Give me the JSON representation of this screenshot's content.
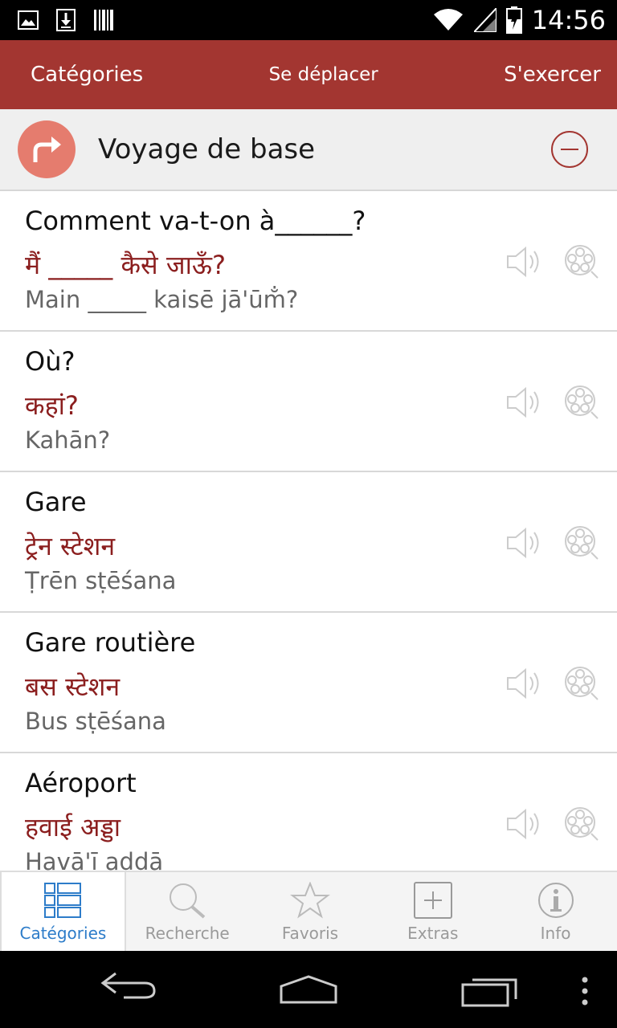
{
  "status_bar": {
    "time": "14:56",
    "icons": [
      "image-notification-icon",
      "download-notification-icon",
      "barcode-notification-icon",
      "wifi-icon",
      "signal-icon",
      "battery-icon"
    ]
  },
  "action_bar": {
    "left": "Catégories",
    "center": "Se déplacer",
    "right": "S'exercer",
    "color": "#a33631"
  },
  "category": {
    "title": "Voyage de base",
    "icon": "turn-right-arrow-icon",
    "icon_color": "#e57c6e"
  },
  "phrases": [
    {
      "french": "Comment va-t-on à______?",
      "hindi": "मैं _____  कैसे जाऊँ?",
      "translit": "Main _____ kaisē jā'ūm̐?"
    },
    {
      "french": "Où?",
      "hindi": "कहां?",
      "translit": "Kahān?"
    },
    {
      "french": "Gare",
      "hindi": "ट्रेन स्टेशन",
      "translit": "Ṭrēn sṭēśana"
    },
    {
      "french": "Gare routière",
      "hindi": "बस स्टेशन",
      "translit": "Bus sṭēśana"
    },
    {
      "french": "Aéroport",
      "hindi": "हवाई अड्डा",
      "translit": "Havā'ī aḍḍā"
    }
  ],
  "tabs": [
    {
      "label": "Catégories",
      "icon": "list-grid-icon",
      "active": true
    },
    {
      "label": "Recherche",
      "icon": "search-icon",
      "active": false
    },
    {
      "label": "Favoris",
      "icon": "star-icon",
      "active": false
    },
    {
      "label": "Extras",
      "icon": "plus-box-icon",
      "active": false
    },
    {
      "label": "Info",
      "icon": "info-icon",
      "active": false
    }
  ],
  "nav_bar": {
    "buttons": [
      "back-icon",
      "home-icon",
      "recents-icon",
      "menu-dots-icon"
    ]
  }
}
